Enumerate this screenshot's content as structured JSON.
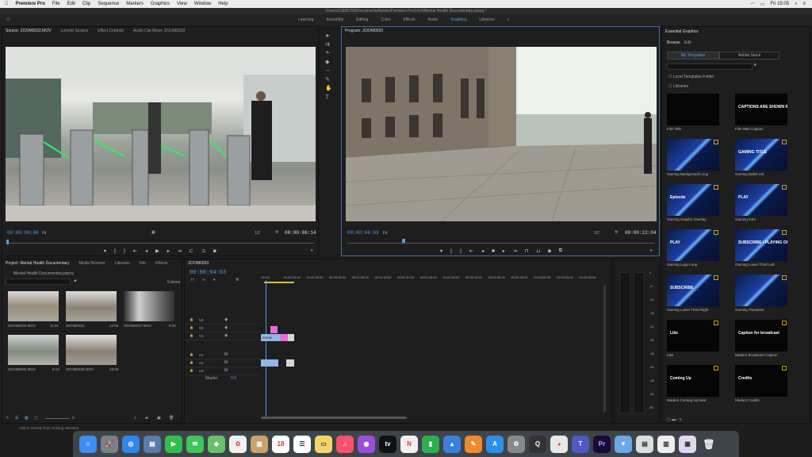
{
  "menubar": {
    "apple": "",
    "app": "Premiere Pro",
    "items": [
      "File",
      "Edit",
      "Clip",
      "Sequence",
      "Markers",
      "Graphics",
      "View",
      "Window",
      "Help"
    ],
    "clock": "Fri 15:05"
  },
  "window": {
    "title": "/Users/10830790/Documents/Adobe/Premiere Pro/14.0/Mental Health Documentary.prproj *"
  },
  "workspaces": {
    "items": [
      "Learning",
      "Assembly",
      "Editing",
      "Color",
      "Effects",
      "Audio",
      "Graphics",
      "Libraries"
    ],
    "active": "Graphics",
    "more": "»"
  },
  "source": {
    "tabs": [
      "Source: ZOOM0032.MOV",
      "Lumetri Scopes",
      "Effect Controls",
      "Audio Clip Mixer: ZOOM0033"
    ],
    "timecode": "00:00:00:00",
    "fit": "Fit",
    "ratio": "1/2",
    "duration": "00:00:06:14"
  },
  "program": {
    "tab": "Program: ZOOM0033",
    "timecode": "00:00:04:03",
    "fit": "Fit",
    "ratio": "1/2",
    "duration": "00:00:22:04"
  },
  "project": {
    "tabs": [
      "Project: Mental Health Documentary",
      "Media Browser",
      "Libraries",
      "Info",
      "Effects"
    ],
    "path": "Mental Health Documentary.prproj",
    "count": "5 items",
    "items": [
      {
        "name": "ZOOM0033.MOV",
        "dur": "11:21"
      },
      {
        "name": "ZOOM0031",
        "dur": "12:04"
      },
      {
        "name": "ZOOM0027.MOV",
        "dur": "8:12"
      },
      {
        "name": "ZOOM0032.MOV",
        "dur": "6:14"
      },
      {
        "name": "ZOOM0030.MOV",
        "dur": "18:00"
      }
    ]
  },
  "timeline": {
    "tab": "ZOOM0033",
    "timecode": "00:00:04:03",
    "ruler": [
      ":00:00",
      "00:00:15:00",
      "00:00:30:00",
      "00:00:45:00",
      "00:01:00:00",
      "00:01:15:00",
      "00:01:30:00",
      "00:01:45:00",
      "00:02:00:00",
      "00:02:15:00",
      "00:02:30:00",
      "00:02:45:00",
      "00:03:00:00",
      "00:03:15:00",
      "00:03:30:00"
    ],
    "tracks": [
      "V3",
      "V2",
      "V1",
      "A1",
      "A2",
      "A3"
    ],
    "master": "Master",
    "master_val": "0.0",
    "clip_label": "ZOOM"
  },
  "meters": [
    "0",
    "-6",
    "-12",
    "-18",
    "-24",
    "-30",
    "-36",
    "-42",
    "-48",
    "-54",
    "dB"
  ],
  "essential_graphics": {
    "title": "Essential Graphics",
    "tabs": [
      "Browse",
      "Edit"
    ],
    "subtabs": [
      "My Templates",
      "Adobe Stock"
    ],
    "search_placeholder": "",
    "checkboxes": [
      "Local Templates Folder",
      "Libraries"
    ],
    "items": [
      {
        "name": "Film Title",
        "art": ""
      },
      {
        "name": "Film Web Caption",
        "art": "CAPTIONS ARE SHOWN IN HERE"
      },
      {
        "name": "Gaming Background Loop",
        "art": ""
      },
      {
        "name": "Gaming Bullet List",
        "art": "GAMING TITLE"
      },
      {
        "name": "Gaming Graphic Overlay",
        "art": "Episode"
      },
      {
        "name": "Gaming Intro",
        "art": "PLAY"
      },
      {
        "name": "Gaming Logo Loop",
        "art": "PLAY"
      },
      {
        "name": "Gaming Lower Third Left",
        "art": "SUBSCRIBE / PLAYING OF"
      },
      {
        "name": "Gaming Lower Third Right",
        "art": "SUBSCRIBE"
      },
      {
        "name": "Gaming Transition",
        "art": ""
      },
      {
        "name": "Like",
        "art": "Like"
      },
      {
        "name": "Modern Broadcast Caption",
        "art": "Caption for broadcast"
      },
      {
        "name": "Modern Coming Up Next",
        "art": "Coming Up"
      },
      {
        "name": "Modern Credits",
        "art": "Credits"
      }
    ]
  },
  "status": "Add or remove from existing selection",
  "colors": {
    "accent": "#4f9ce8",
    "badge": "#d9a400",
    "clip_pink": "#e86bd4",
    "clip_blue": "#8fb6e6"
  }
}
